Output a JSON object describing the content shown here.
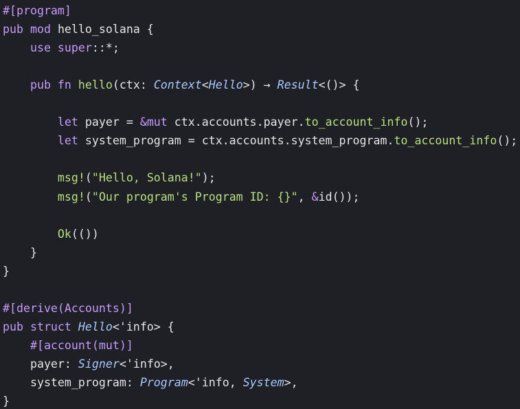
{
  "colors": {
    "background": "#1f1f26",
    "text": "#e6e6e6",
    "keyword": "#c49bff",
    "function": "#b9e07e",
    "type": "#a9c9ff",
    "string": "#b9e07e",
    "attribute": "#c49bff",
    "lifetime": "#e6e6e6"
  },
  "code_lines": [
    [
      {
        "t": "#[program]",
        "c": "attribute"
      }
    ],
    [
      {
        "t": "pub mod ",
        "c": "keyword"
      },
      {
        "t": "hello_solana {",
        "c": "text"
      }
    ],
    [
      {
        "t": "    use super",
        "c": "keyword"
      },
      {
        "t": "::*;",
        "c": "text"
      }
    ],
    [],
    [
      {
        "t": "    pub fn ",
        "c": "keyword"
      },
      {
        "t": "hello",
        "c": "function"
      },
      {
        "t": "(ctx: ",
        "c": "text"
      },
      {
        "t": "Context",
        "c": "type",
        "i": true
      },
      {
        "t": "<",
        "c": "text"
      },
      {
        "t": "Hello",
        "c": "type",
        "i": true
      },
      {
        "t": ">) → ",
        "c": "text"
      },
      {
        "t": "Result",
        "c": "type",
        "i": true
      },
      {
        "t": "<()> {",
        "c": "text"
      }
    ],
    [],
    [
      {
        "t": "        let ",
        "c": "keyword"
      },
      {
        "t": "payer = ",
        "c": "text"
      },
      {
        "t": "&mut ",
        "c": "keyword"
      },
      {
        "t": "ctx.accounts.payer.",
        "c": "text"
      },
      {
        "t": "to_account_info",
        "c": "function"
      },
      {
        "t": "();",
        "c": "text"
      }
    ],
    [
      {
        "t": "        let ",
        "c": "keyword"
      },
      {
        "t": "system_program = ctx.accounts.system_program.",
        "c": "text"
      },
      {
        "t": "to_account_info",
        "c": "function"
      },
      {
        "t": "();",
        "c": "text"
      }
    ],
    [],
    [
      {
        "t": "        msg!",
        "c": "function"
      },
      {
        "t": "(",
        "c": "text"
      },
      {
        "t": "\"Hello, Solana!\"",
        "c": "string"
      },
      {
        "t": ");",
        "c": "text"
      }
    ],
    [
      {
        "t": "        msg!",
        "c": "function"
      },
      {
        "t": "(",
        "c": "text"
      },
      {
        "t": "\"Our program's Program ID: {}\"",
        "c": "string"
      },
      {
        "t": ", ",
        "c": "text"
      },
      {
        "t": "&",
        "c": "keyword"
      },
      {
        "t": "id());",
        "c": "text"
      }
    ],
    [],
    [
      {
        "t": "        Ok",
        "c": "function"
      },
      {
        "t": "(())",
        "c": "text"
      }
    ],
    [
      {
        "t": "    }",
        "c": "text"
      }
    ],
    [
      {
        "t": "}",
        "c": "text"
      }
    ],
    [],
    [
      {
        "t": "#[derive(Accounts)]",
        "c": "attribute"
      }
    ],
    [
      {
        "t": "pub struct ",
        "c": "keyword"
      },
      {
        "t": "Hello",
        "c": "type",
        "i": true
      },
      {
        "t": "<'info> {",
        "c": "text"
      }
    ],
    [
      {
        "t": "    #[account(mut)]",
        "c": "attribute"
      }
    ],
    [
      {
        "t": "    payer: ",
        "c": "text"
      },
      {
        "t": "Signer",
        "c": "type",
        "i": true
      },
      {
        "t": "<'info>,",
        "c": "text"
      }
    ],
    [
      {
        "t": "    system_program: ",
        "c": "text"
      },
      {
        "t": "Program",
        "c": "type",
        "i": true
      },
      {
        "t": "<'info, ",
        "c": "text"
      },
      {
        "t": "System",
        "c": "type",
        "i": true
      },
      {
        "t": ">,",
        "c": "text"
      }
    ],
    [
      {
        "t": "}",
        "c": "text"
      }
    ]
  ]
}
